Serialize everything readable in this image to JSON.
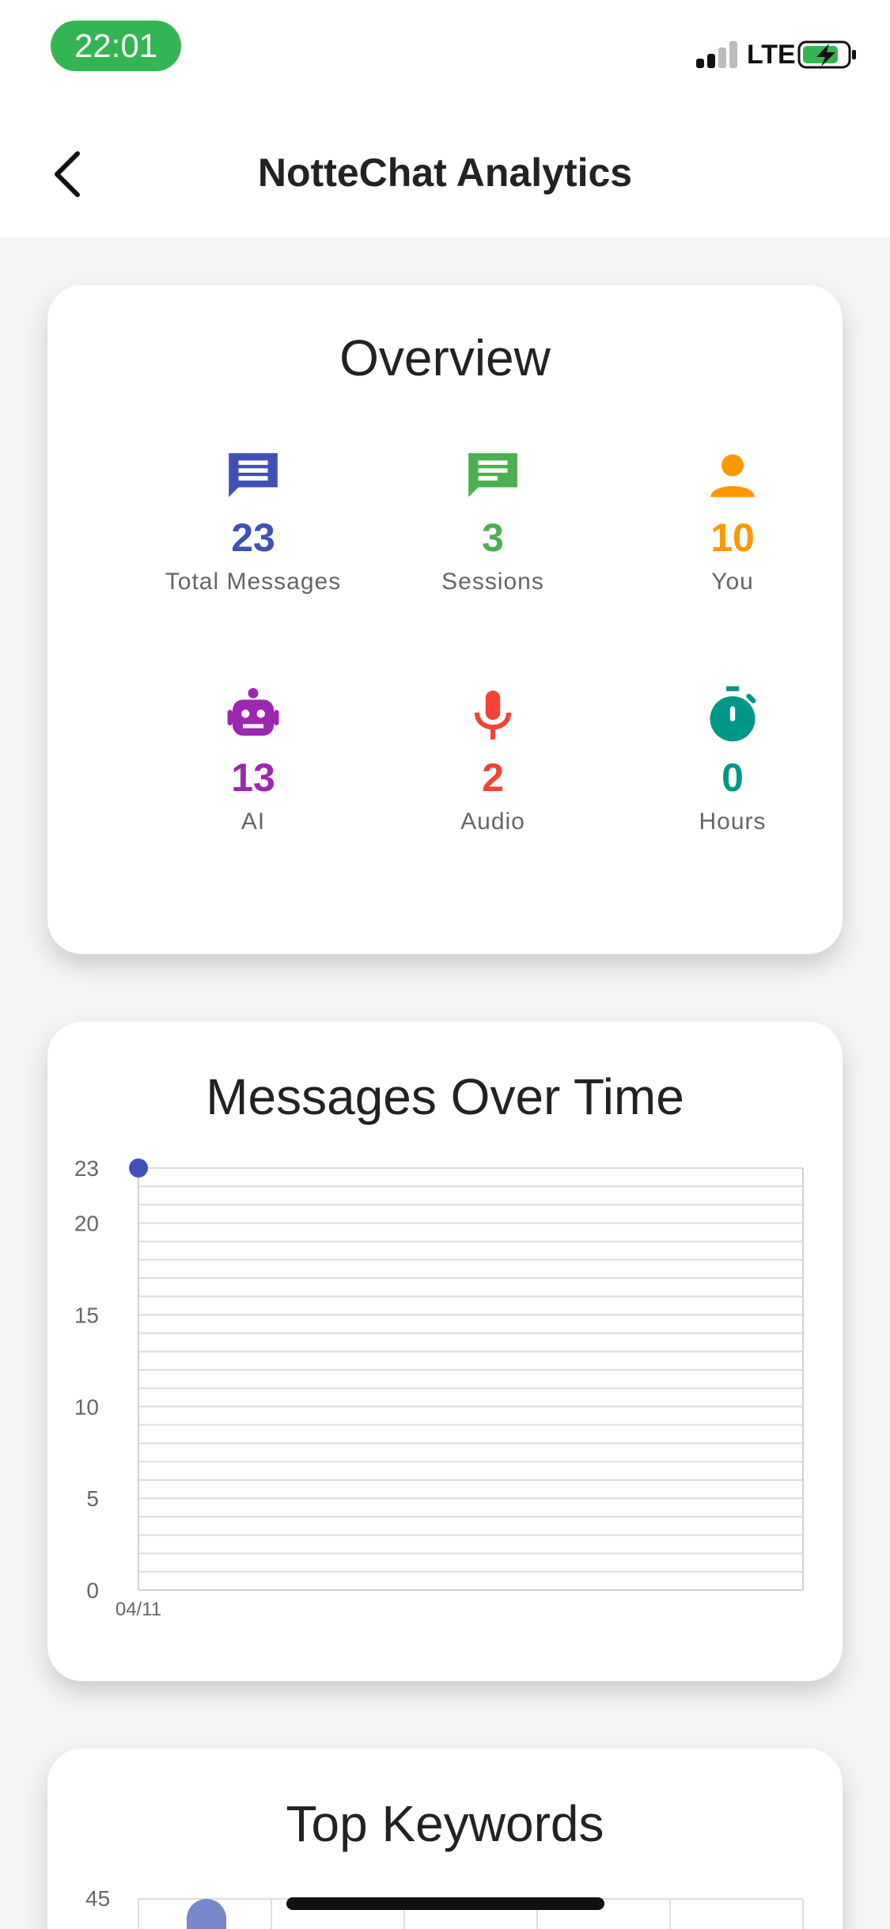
{
  "status_bar": {
    "time": "22:01",
    "network": "LTE",
    "colors": {
      "time_pill": "#34b553",
      "battery": "#34b553"
    }
  },
  "nav": {
    "title": "NotteChat Analytics",
    "back_icon": "chevron-left-icon"
  },
  "overview": {
    "title": "Overview",
    "stats": [
      {
        "icon": "message-icon",
        "value": "23",
        "label": "Total Messages",
        "color": "#3f51b5"
      },
      {
        "icon": "chat-icon",
        "value": "3",
        "label": "Sessions",
        "color": "#4caf50"
      },
      {
        "icon": "person-icon",
        "value": "10",
        "label": "You",
        "color": "#ff9800"
      },
      {
        "icon": "robot-icon",
        "value": "13",
        "label": "AI",
        "color": "#9c27b0"
      },
      {
        "icon": "microphone-icon",
        "value": "2",
        "label": "Audio",
        "color": "#f44336"
      },
      {
        "icon": "timer-icon",
        "value": "0",
        "label": "Hours",
        "color": "#009688"
      }
    ]
  },
  "messages_over_time": {
    "title": "Messages Over Time",
    "chart_data": {
      "type": "line",
      "x": [
        "04/11"
      ],
      "series": [
        {
          "values": [
            23
          ],
          "color": "#3f51b5"
        }
      ],
      "yticks": [
        0,
        5,
        10,
        15,
        20,
        23
      ],
      "ylim": [
        0,
        23
      ],
      "grid": true
    }
  },
  "top_keywords": {
    "title": "Top Keywords",
    "chart_data": {
      "type": "bar",
      "ytick_visible": "45",
      "series_color": "#7986cb"
    }
  }
}
